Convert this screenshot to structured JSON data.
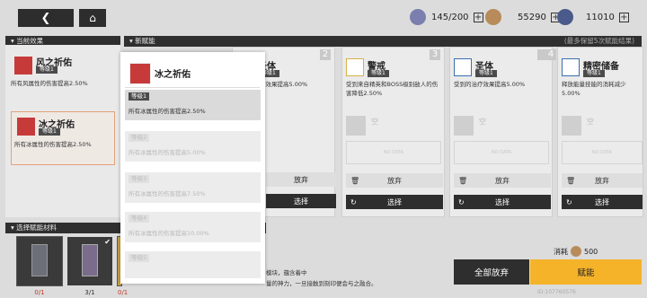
{
  "header": {
    "resources": [
      {
        "icon": "gem-icon",
        "value": "145/200",
        "color": "#7a7fae"
      },
      {
        "icon": "coin-icon",
        "value": "55290",
        "color": "#b88b5a"
      },
      {
        "icon": "star-shard-icon",
        "value": "11010",
        "color": "#4a5a8a"
      }
    ],
    "plus": "+"
  },
  "sections": {
    "current_effects": "当前效果",
    "new_talents": "新赋能",
    "max_hint": "(最多保留5次赋能结果)",
    "select_materials": "选择赋能材料"
  },
  "current_effects": [
    {
      "name": "风之祈佑",
      "level": "等级1",
      "desc": "所有风属性的伤害提高2.50%"
    },
    {
      "name": "冰之祈佑",
      "level": "等级1",
      "desc": "所有冰属性的伤害提高2.50%"
    }
  ],
  "cards": [
    {
      "num": "2",
      "name": "圣体",
      "level": "等级1",
      "desc": "受到的治疗效果提高5.00%",
      "slot": "空",
      "nodata": "NO DATA",
      "discard": "放弃",
      "select": "选择"
    },
    {
      "num": "3",
      "name": "警戒",
      "level": "等级1",
      "desc": "受到来自精英和BOSS级别敌人的伤害降低2.50%",
      "slot": "空",
      "nodata": "NO DATA",
      "discard": "放弃",
      "select": "选择"
    },
    {
      "num": "",
      "name": "圣体",
      "level": "等级1",
      "desc": "受到的治疗效果提高5.00%",
      "slot": "空",
      "nodata": "NO DATA",
      "discard": "放弃",
      "select": "选择"
    },
    {
      "num": "4",
      "name": "精密储备",
      "level": "等级1",
      "desc": "释放能量技能的消耗减少5.00%",
      "slot": "空",
      "nodata": "NO DATA",
      "discard": "放弃",
      "select": "选择"
    }
  ],
  "popup": {
    "name": "冰之祈佑",
    "rows": [
      {
        "level": "等级1",
        "desc": "所有冰属性的伤害提高2.50%"
      },
      {
        "level": "等级2",
        "desc": "所有冰属性的伤害提高5.00%"
      },
      {
        "level": "等级3",
        "desc": "所有冰属性的伤害提高7.50%"
      },
      {
        "level": "等级4",
        "desc": "所有冰属性的伤害提高10.00%"
      },
      {
        "level": "等级5",
        "desc": ""
      }
    ]
  },
  "materials": [
    {
      "count": "0/1"
    },
    {
      "count": "3/1"
    },
    {
      "count": "0/1"
    }
  ],
  "bottom": {
    "desc_line1": "模块，蕴含着中",
    "desc_line2": "量的神力，一旦接触到刻印便会与之融合。",
    "cost_label": "消耗",
    "cost_value": "500",
    "discard_all": "全部放弃",
    "empower": "赋能",
    "uid": "ID:107760576"
  }
}
